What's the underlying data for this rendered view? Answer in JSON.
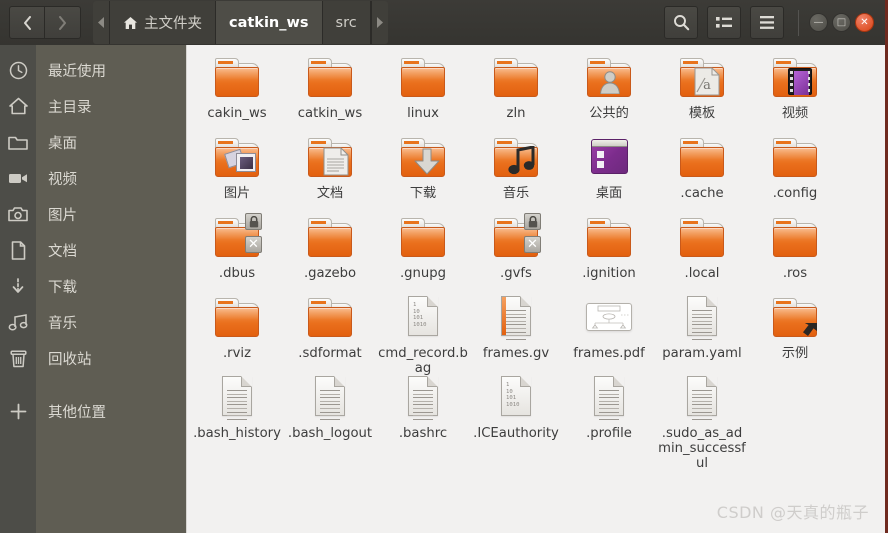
{
  "window": {
    "nav": {
      "back": "‹",
      "forward": "›"
    },
    "tabs": [
      {
        "label": "主文件夹",
        "icon": "home-icon",
        "active": false
      },
      {
        "label": "catkin_ws",
        "icon": "",
        "active": true
      },
      {
        "label": "src",
        "icon": "",
        "active": false
      }
    ],
    "tools": [
      {
        "name": "search-icon",
        "label": ""
      },
      {
        "name": "view-list-icon",
        "label": ""
      },
      {
        "name": "menu-icon",
        "label": ""
      }
    ],
    "controls": [
      {
        "name": "minimize-button",
        "glyph": "—"
      },
      {
        "name": "maximize-button",
        "glyph": "□"
      },
      {
        "name": "close-button",
        "glyph": "✕"
      }
    ]
  },
  "sidebar": {
    "items": [
      {
        "label": "最近使用",
        "icon": "clock-icon"
      },
      {
        "label": "主目录",
        "icon": "home-icon"
      },
      {
        "label": "桌面",
        "icon": "folder-icon"
      },
      {
        "label": "视频",
        "icon": "video-icon"
      },
      {
        "label": "图片",
        "icon": "camera-icon"
      },
      {
        "label": "文档",
        "icon": "document-icon"
      },
      {
        "label": "下载",
        "icon": "download-icon"
      },
      {
        "label": "音乐",
        "icon": "music-icon"
      },
      {
        "label": "回收站",
        "icon": "trash-icon"
      },
      {
        "label": "其他位置",
        "icon": "plus-icon",
        "gap_before": true
      }
    ]
  },
  "files": {
    "columns": 7,
    "items": [
      {
        "name": "cakin_ws",
        "type": "folder"
      },
      {
        "name": "catkin_ws",
        "type": "folder"
      },
      {
        "name": "linux",
        "type": "folder"
      },
      {
        "name": "zln",
        "type": "folder"
      },
      {
        "name": "公共的",
        "type": "folder",
        "emblem": "user-emblem"
      },
      {
        "name": "模板",
        "type": "folder",
        "emblem": "template-emblem"
      },
      {
        "name": "视频",
        "type": "folder",
        "emblem": "film-emblem"
      },
      {
        "name": "图片",
        "type": "folder",
        "emblem": "pictures-emblem"
      },
      {
        "name": "文档",
        "type": "folder",
        "emblem": "documents-emblem"
      },
      {
        "name": "下载",
        "type": "folder",
        "emblem": "download-emblem"
      },
      {
        "name": "音乐",
        "type": "folder",
        "emblem": "music-emblem"
      },
      {
        "name": "桌面",
        "type": "desktop"
      },
      {
        "name": ".cache",
        "type": "folder"
      },
      {
        "name": ".config",
        "type": "folder"
      },
      {
        "name": ".dbus",
        "type": "folder",
        "badges": [
          "lock-emblem",
          "x-emblem"
        ]
      },
      {
        "name": ".gazebo",
        "type": "folder"
      },
      {
        "name": ".gnupg",
        "type": "folder"
      },
      {
        "name": ".gvfs",
        "type": "folder",
        "badges": [
          "lock-emblem",
          "x-emblem"
        ]
      },
      {
        "name": ".ignition",
        "type": "folder"
      },
      {
        "name": ".local",
        "type": "folder"
      },
      {
        "name": ".ros",
        "type": "folder"
      },
      {
        "name": ".rviz",
        "type": "folder"
      },
      {
        "name": ".sdformat",
        "type": "folder"
      },
      {
        "name": "cmd_record.bag",
        "type": "binary"
      },
      {
        "name": "frames.gv",
        "type": "text-orange"
      },
      {
        "name": "frames.pdf",
        "type": "pdf"
      },
      {
        "name": "param.yaml",
        "type": "text"
      },
      {
        "name": "示例",
        "type": "folder",
        "badges": [
          "link-emblem"
        ]
      },
      {
        "name": ".bash_history",
        "type": "text"
      },
      {
        "name": ".bash_logout",
        "type": "text"
      },
      {
        "name": ".bashrc",
        "type": "text"
      },
      {
        "name": ".ICEauthority",
        "type": "binary"
      },
      {
        "name": ".profile",
        "type": "text"
      },
      {
        "name": ".sudo_as_admin_successful",
        "type": "text"
      }
    ],
    "binary_glyph": "1\n10\n101\n1010"
  },
  "watermark": "CSDN @天真的瓶子",
  "colors": {
    "folder": "#e8741d",
    "header": "#3c3b37",
    "sidebar": "#5f5d53",
    "sidebar_icons": "#4d4d48",
    "content": "#f2f1f0",
    "close": "#d94213",
    "desktop_purple": "#8c35a0"
  }
}
